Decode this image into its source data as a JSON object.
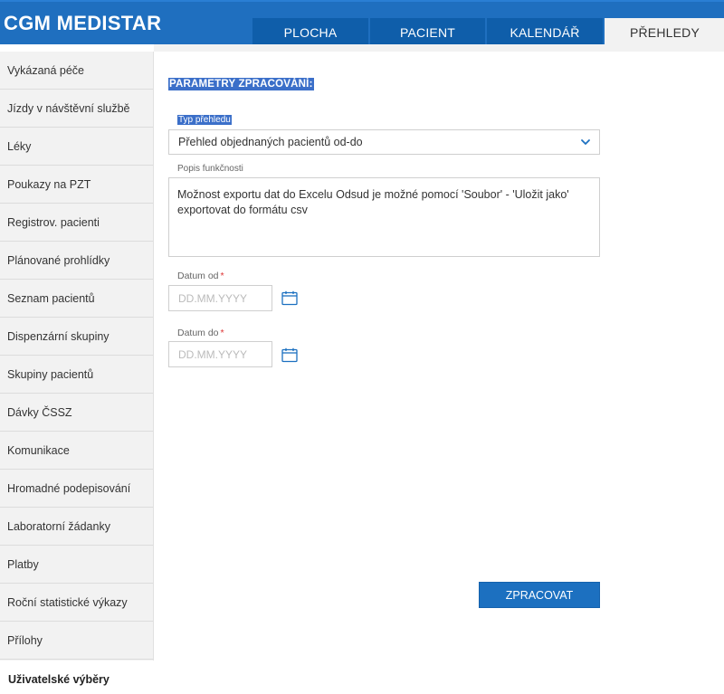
{
  "app": {
    "logo_text": "CGM MEDISTAR",
    "brand_color": "#1f6fbf"
  },
  "tabs": [
    {
      "label": "PLOCHA",
      "active": false
    },
    {
      "label": "PACIENT",
      "active": false
    },
    {
      "label": "KALENDÁŘ",
      "active": false
    },
    {
      "label": "PŘEHLEDY",
      "active": true
    }
  ],
  "sidebar": {
    "items": [
      {
        "label": "Vykázaná péče"
      },
      {
        "label": "Jízdy v návštěvní službě"
      },
      {
        "label": "Léky"
      },
      {
        "label": "Poukazy na PZT"
      },
      {
        "label": "Registrov. pacienti"
      },
      {
        "label": "Plánované prohlídky"
      },
      {
        "label": "Seznam pacientů"
      },
      {
        "label": "Dispenzární skupiny"
      },
      {
        "label": "Skupiny pacientů"
      },
      {
        "label": "Dávky ČSSZ"
      },
      {
        "label": "Komunikace"
      },
      {
        "label": "Hromadné podepisování"
      },
      {
        "label": "Laboratorní žádanky"
      },
      {
        "label": "Platby"
      },
      {
        "label": "Roční statistické výkazy"
      },
      {
        "label": "Přílohy"
      }
    ],
    "user_selections_label": "Uživatelské výběry"
  },
  "form": {
    "section_title": "PARAMETRY ZPRACOVÁNÍ:",
    "type_label": "Typ přehledu",
    "type_value": "Přehled objednaných pacientů od-do",
    "description_label": "Popis funkčnosti",
    "description_text": "Možnost exportu dat do Excelu  Odsud je možné pomocí 'Soubor' - 'Uložit jako' exportovat do formátu csv",
    "date_from_label": "Datum od",
    "date_to_label": "Datum do",
    "required_mark": "*",
    "date_placeholder": "DD.MM.YYYY",
    "submit_label": "ZPRACOVAT"
  },
  "icons": {
    "dropdown": "chevron-down-icon",
    "date_picker": "calendar-icon"
  }
}
